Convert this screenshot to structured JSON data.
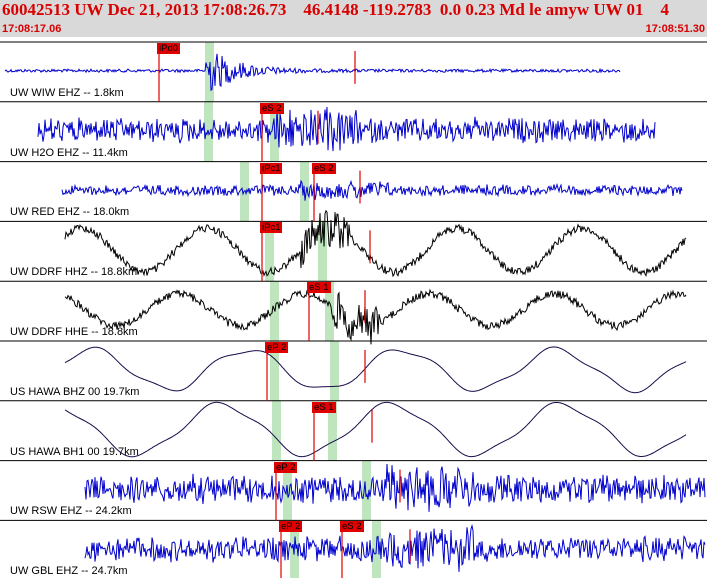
{
  "header": {
    "title": "60042513 UW Dec 21, 2013 17:08:26.73    46.4148 -119.2783  0.0 0.23 Md le amyw UW 01    4",
    "time_start": "17:08:17.06",
    "time_end": "17:08:51.30"
  },
  "colors": {
    "title": "#d80000",
    "header_bg": "#d9d9d9",
    "blue": "#0000cc",
    "black": "#000000",
    "navy": "#1a0a4a",
    "pick": "#e00000",
    "window": "#bfe5bf"
  },
  "traces": [
    {
      "label": "UW WIW EHZ -- 1.8km",
      "picks": [
        {
          "text": "iPd0",
          "time": 2.1
        }
      ]
    },
    {
      "label": "UW H2O EHZ -- 11.4km",
      "picks": [
        {
          "text": "eS 2",
          "time": 4.3
        }
      ]
    },
    {
      "label": "UW RED EHZ -- 18.0km",
      "picks": [
        {
          "text": "iPc1",
          "time": 4.3
        },
        {
          "text": "eS 2",
          "time": 5.4
        }
      ]
    },
    {
      "label": "UW DDRF HHZ -- 18.8km",
      "picks": [
        {
          "text": "iPc1",
          "time": 4.3
        }
      ]
    },
    {
      "label": "UW DDRF HHE -- 18.8km",
      "picks": [
        {
          "text": "eS 1",
          "time": 5.3
        }
      ]
    },
    {
      "label": "US HAWA BHZ 00 19.7km",
      "picks": [
        {
          "text": "eP 2",
          "time": 4.4
        }
      ]
    },
    {
      "label": "US HAWA BH1 00 19.7km",
      "picks": [
        {
          "text": "eS 1",
          "time": 5.4
        }
      ]
    },
    {
      "label": "UW RSW EHZ -- 24.2km",
      "picks": [
        {
          "text": "eP 2",
          "time": 4.6
        }
      ]
    },
    {
      "label": "UW GBL EHZ -- 24.7km",
      "picks": [
        {
          "text": "eP 2",
          "time": 4.7
        },
        {
          "text": "eS 2",
          "time": 6.0
        }
      ]
    }
  ]
}
